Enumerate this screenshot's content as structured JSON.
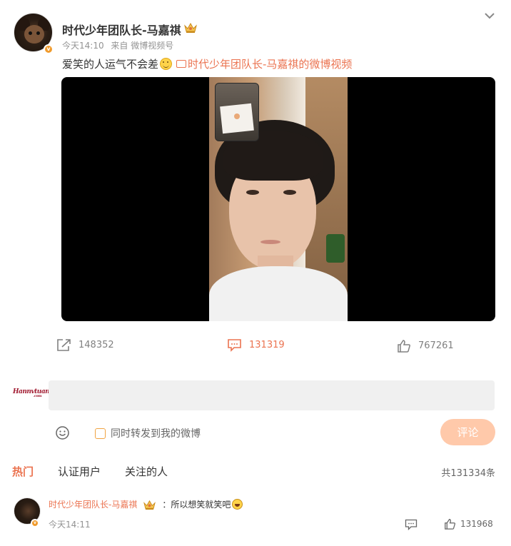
{
  "post": {
    "author": "时代少年团队长-马嘉祺",
    "time": "今天14:10",
    "source": "来自 微博视频号",
    "text": "爱笑的人运气不会差",
    "video_link": "时代少年团队长-马嘉祺的微博视频"
  },
  "actions": {
    "share_count": "148352",
    "comment_count": "131319",
    "like_count": "767261"
  },
  "comment_box": {
    "logo_text": "Hannvtuan",
    "input_value": "",
    "repost_label": "同时转发到我的微博",
    "submit_label": "评论"
  },
  "tabs": [
    {
      "label": "热门",
      "active": true
    },
    {
      "label": "认证用户",
      "active": false
    },
    {
      "label": "关注的人",
      "active": false
    }
  ],
  "total": "共131334条",
  "comments": [
    {
      "author": "时代少年团队长-马嘉祺",
      "text": "：所以想笑就笑吧",
      "time": "今天14:11",
      "like_count": "131968"
    }
  ],
  "colors": {
    "accent": "#eb7350",
    "verified": "#f09b2d",
    "submit_disabled": "#ffc9aa"
  },
  "icons": [
    "crown-icon",
    "chevron-down-icon",
    "smile-icon",
    "video-icon",
    "share-icon",
    "comment-icon",
    "like-icon",
    "emoji-icon",
    "laugh-icon"
  ]
}
